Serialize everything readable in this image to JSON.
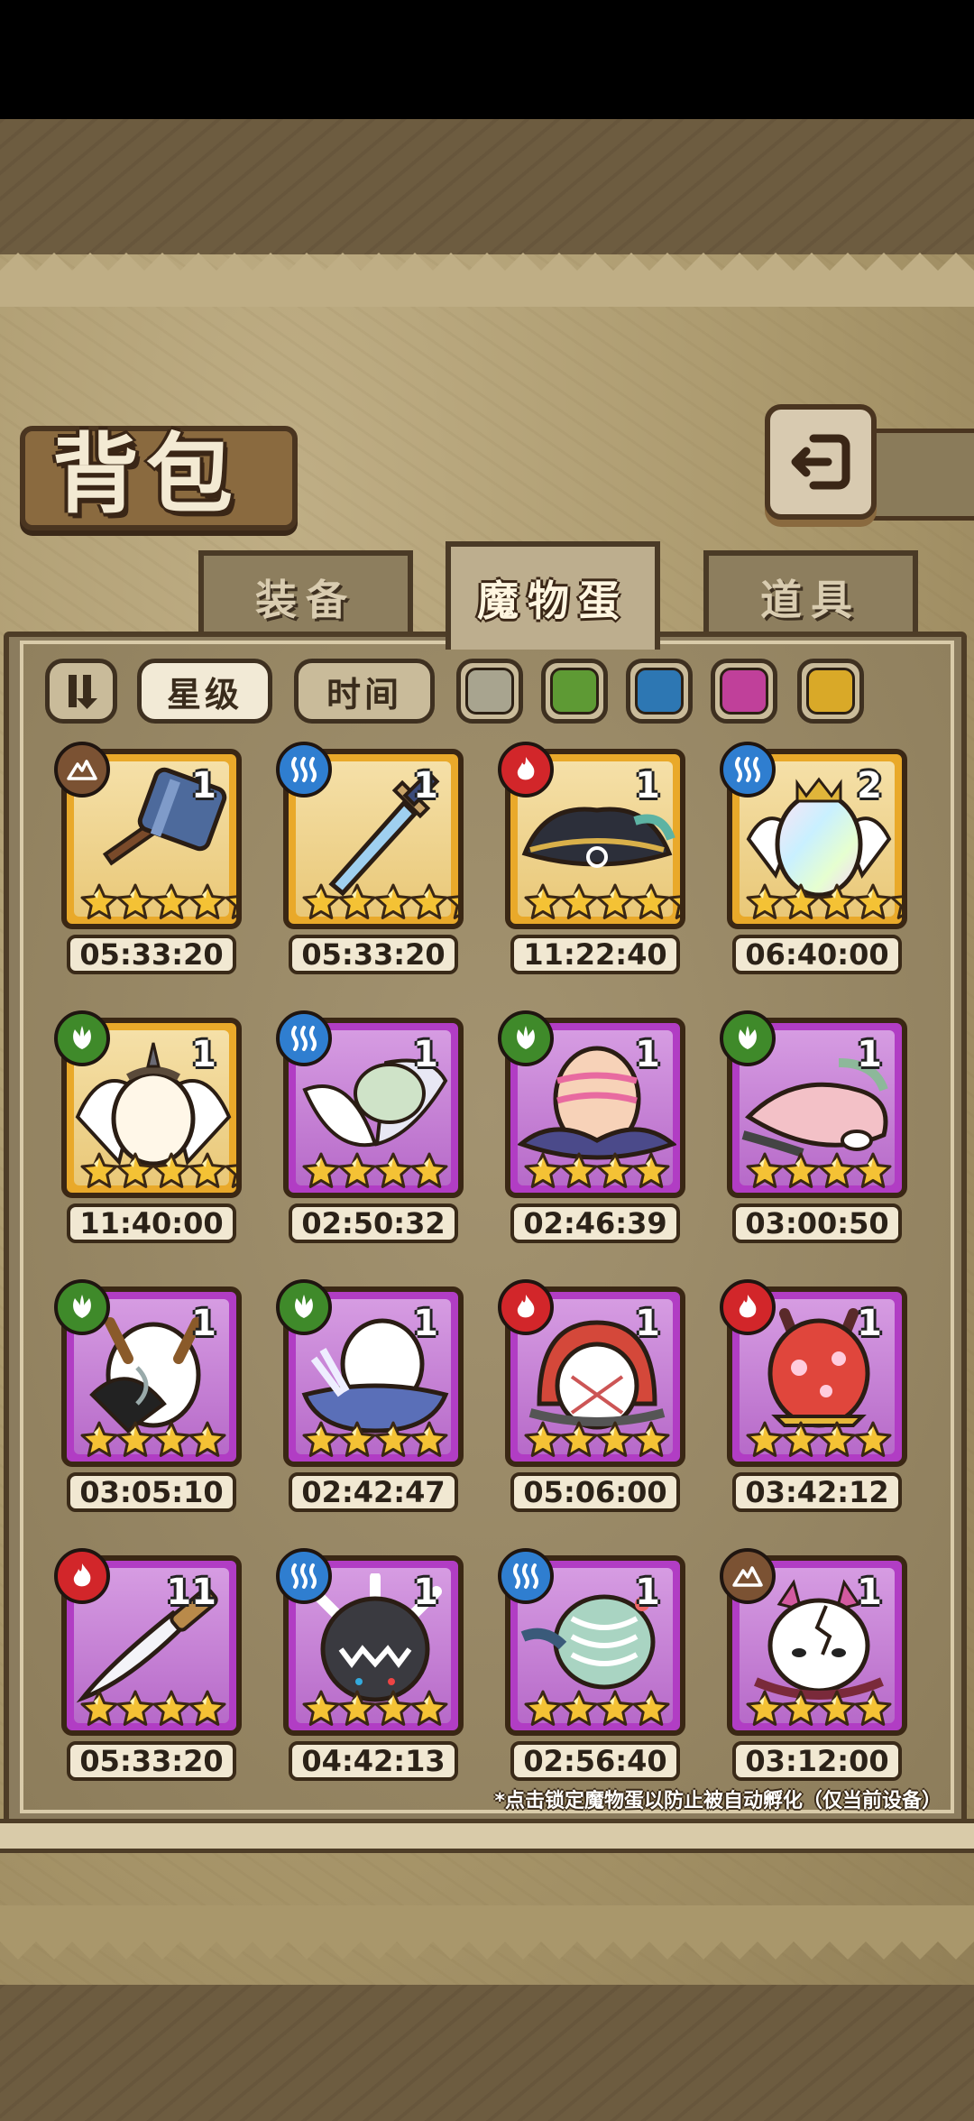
{
  "title": "背包",
  "tabs": [
    {
      "label": "装备",
      "active": false
    },
    {
      "label": "魔物蛋",
      "active": true
    },
    {
      "label": "道具",
      "active": false
    }
  ],
  "filters": {
    "sort_toggle_icon": "sort-order-icon",
    "star_label": "星级",
    "time_label": "时间",
    "rarity_colors": [
      "#a8a48f",
      "#5e9a34",
      "#2d77b3",
      "#c0409a",
      "#d9a928"
    ]
  },
  "eggs": [
    {
      "element": "earth",
      "frame": "gold",
      "count": "1",
      "stars": 5,
      "timer": "05:33:20",
      "art": "hammer"
    },
    {
      "element": "water",
      "frame": "gold",
      "count": "1",
      "stars": 5,
      "timer": "05:33:20",
      "art": "dagger"
    },
    {
      "element": "fire",
      "frame": "gold",
      "count": "1",
      "stars": 5,
      "timer": "11:22:40",
      "art": "pirate-hat"
    },
    {
      "element": "water",
      "frame": "gold",
      "count": "2",
      "stars": 5,
      "timer": "06:40:00",
      "art": "rainbow-egg"
    },
    {
      "element": "nature",
      "frame": "gold",
      "count": "1",
      "stars": 5,
      "timer": "11:40:00",
      "art": "winged-egg"
    },
    {
      "element": "water",
      "frame": "purple",
      "count": "1",
      "stars": 4,
      "timer": "02:50:32",
      "art": "feather-egg"
    },
    {
      "element": "nature",
      "frame": "purple",
      "count": "1",
      "stars": 4,
      "timer": "02:46:39",
      "art": "nest-egg"
    },
    {
      "element": "nature",
      "frame": "purple",
      "count": "1",
      "stars": 4,
      "timer": "03:00:50",
      "art": "pink-creature"
    },
    {
      "element": "nature",
      "frame": "purple",
      "count": "1",
      "stars": 4,
      "timer": "03:05:10",
      "art": "horned-egg"
    },
    {
      "element": "nature",
      "frame": "purple",
      "count": "1",
      "stars": 4,
      "timer": "02:42:47",
      "art": "blue-egg"
    },
    {
      "element": "fire",
      "frame": "purple",
      "count": "1",
      "stars": 4,
      "timer": "05:06:00",
      "art": "hooded-egg"
    },
    {
      "element": "fire",
      "frame": "purple",
      "count": "1",
      "stars": 4,
      "timer": "03:42:12",
      "art": "red-spotted-egg"
    },
    {
      "element": "fire",
      "frame": "purple",
      "count": "11",
      "stars": 4,
      "timer": "05:33:20",
      "art": "knife"
    },
    {
      "element": "water",
      "frame": "purple",
      "count": "1",
      "stars": 4,
      "timer": "04:42:13",
      "art": "spiked-black-egg"
    },
    {
      "element": "water",
      "frame": "purple",
      "count": "1",
      "stars": 4,
      "timer": "02:56:40",
      "art": "skeleton-egg"
    },
    {
      "element": "earth",
      "frame": "purple",
      "count": "1",
      "stars": 4,
      "timer": "03:12:00",
      "art": "cracked-egg"
    }
  ],
  "hint": "*点击锁定魔物蛋以防止被自动孵化（仅当前设备）"
}
